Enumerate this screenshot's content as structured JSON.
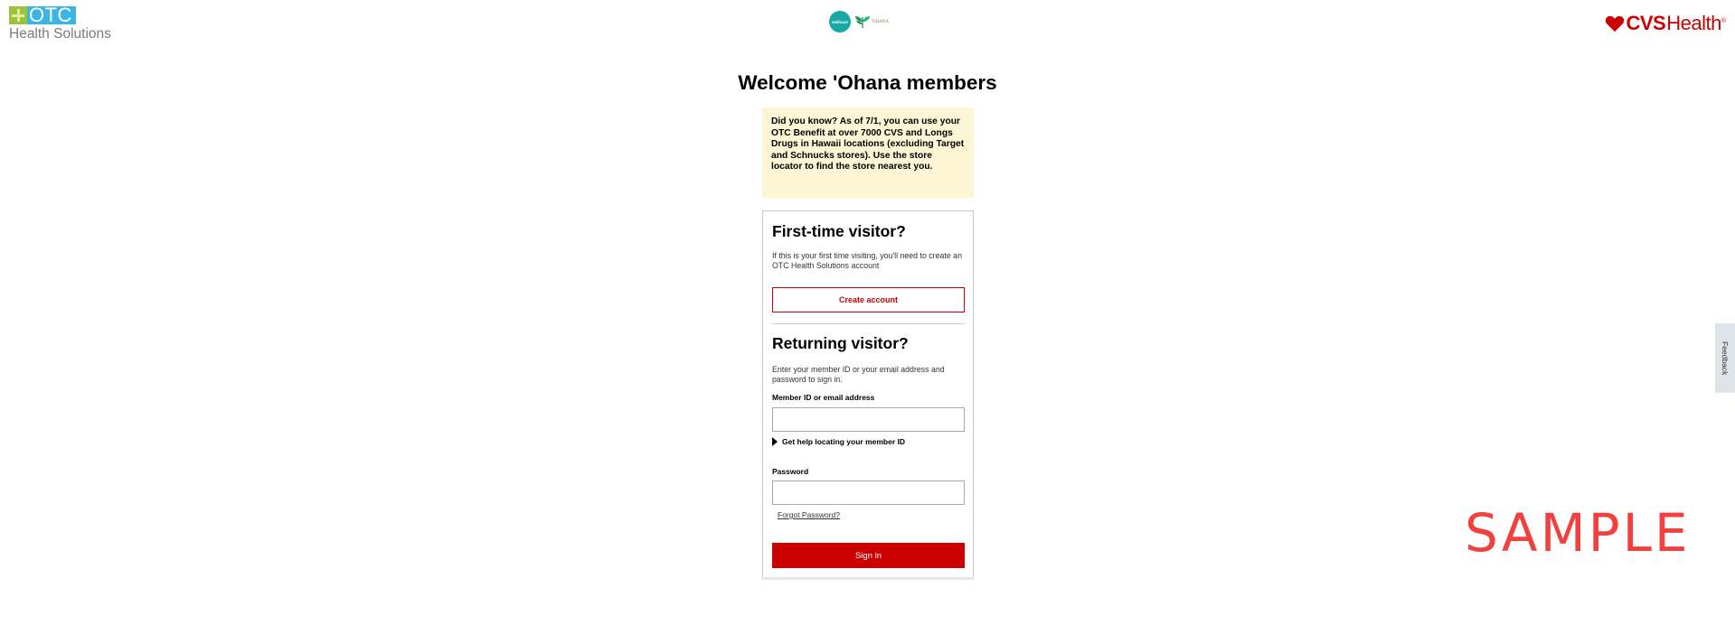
{
  "header": {
    "otc_logo": {
      "top_text": "OTC",
      "bottom_text": "Health Solutions"
    },
    "partner_logos": {
      "wellcare_text": "wellcare",
      "ohana_text": "'OHANA"
    },
    "cvs_logo": {
      "bold_text": "CVS",
      "text": "Health",
      "registered": "®"
    }
  },
  "page": {
    "title": "Welcome 'Ohana members"
  },
  "notice": {
    "text": "Did you know? As of 7/1, you can use your OTC Benefit at over 7000 CVS and Longs Drugs in Hawaii locations (excluding Target and Schnucks stores). Use the store locator to find the store nearest you."
  },
  "first_time": {
    "heading": "First-time visitor?",
    "text": "If this is your first time visiting, you'll need to create an OTC Health Solutions account",
    "create_button": "Create account"
  },
  "returning": {
    "heading": "Returning visitor?",
    "text": "Enter your member ID or your email address and password to sign in.",
    "member_label": "Member ID or email address",
    "member_value": "",
    "help_label": "Get help locating your member ID",
    "password_label": "Password",
    "password_value": "",
    "forgot_label": "Forgot Password?",
    "signin_button": "Sign in"
  },
  "feedback": {
    "label": "Feedback"
  },
  "watermark": {
    "text": "SAMPLE"
  },
  "colors": {
    "brand_red": "#cc0000",
    "notice_bg": "#fdf6d5",
    "otc_blue": "#3cb5e5",
    "otc_green": "#9bc43c",
    "wellcare_teal": "#1aa8a6",
    "watermark": "#f0413e"
  },
  "icons": {
    "otc": "otc-cross-icon",
    "heart": "cvs-heart-icon",
    "ohana": "ohana-leaf-icon",
    "caret": "caret-right-icon"
  }
}
